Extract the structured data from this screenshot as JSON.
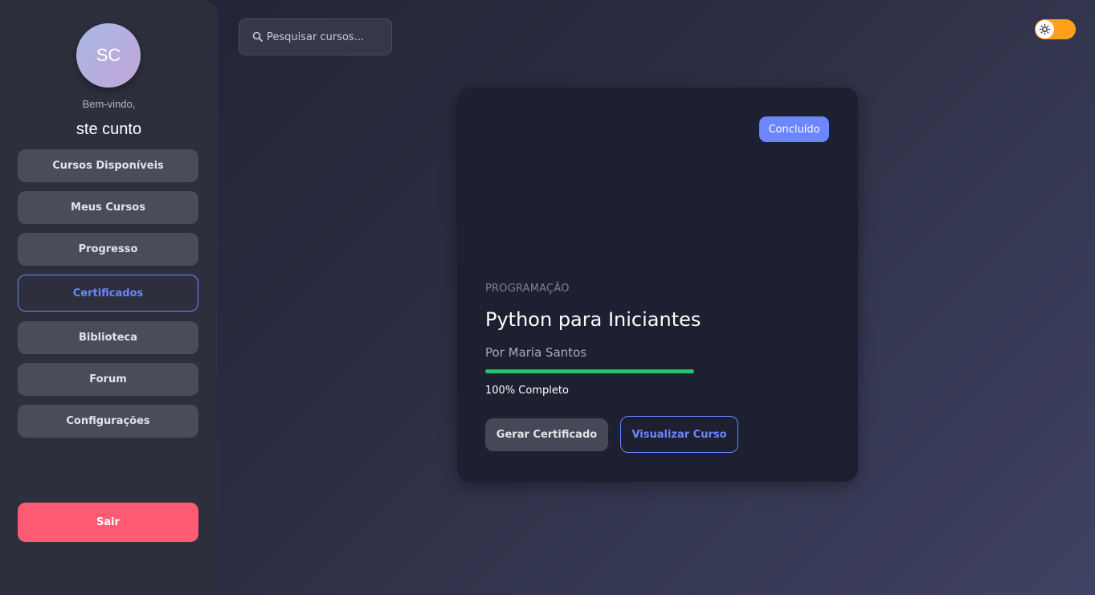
{
  "sidebar": {
    "avatar_initials": "SC",
    "welcome": "Bem-vindo,",
    "username": "ste cunto",
    "items": [
      {
        "label": "Cursos Disponíveis",
        "active": false
      },
      {
        "label": "Meus Cursos",
        "active": false
      },
      {
        "label": "Progresso",
        "active": false
      },
      {
        "label": "Certificados",
        "active": true
      },
      {
        "label": "Biblioteca",
        "active": false
      },
      {
        "label": "Forum",
        "active": false
      },
      {
        "label": "Configurações",
        "active": false
      }
    ],
    "logout_label": "Sair"
  },
  "header": {
    "search_placeholder": "Pesquisar cursos...",
    "search_icon": "search-icon",
    "theme_toggle_icon": "sun-icon"
  },
  "course_card": {
    "status_badge": "Concluído",
    "category": "PROGRAMAÇÃO",
    "title": "Python para Iniciantes",
    "author": "Por Maria Santos",
    "progress_percent": 100,
    "progress_text": "100% Completo",
    "certificate_button": "Gerar Certificado",
    "view_button": "Visualizar Curso"
  },
  "colors": {
    "accent": "#6b86ff",
    "logout": "#ff5c74",
    "progress": "#28c46b",
    "toggle": "#ff9f1a"
  }
}
